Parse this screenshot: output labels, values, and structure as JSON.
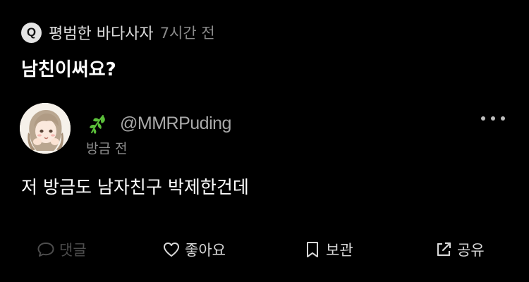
{
  "question": {
    "badge": "Q",
    "asker": "평범한 바다사자",
    "time": "7시간 전",
    "text": "남친이써요?"
  },
  "answer": {
    "handle": "@MMRPuding",
    "time": "방금 전",
    "text": "저 방금도 남자친구 박제한건데",
    "badge_icon": "leaf-icon",
    "more_icon": "more-dots-icon"
  },
  "actions": [
    {
      "label": "댓글",
      "icon": "comment-icon",
      "color": "#4d4d4d"
    },
    {
      "label": "좋아요",
      "icon": "heart-icon",
      "color": "#d8d8d8"
    },
    {
      "label": "보관",
      "icon": "bookmark-icon",
      "color": "#d8d8d8"
    },
    {
      "label": "공유",
      "icon": "share-icon",
      "color": "#d8d8d8"
    }
  ],
  "colors": {
    "background": "#000000",
    "primary_text": "#ffffff",
    "secondary_text": "#8a8a8a",
    "leaf_green": "#5bbf3a"
  }
}
